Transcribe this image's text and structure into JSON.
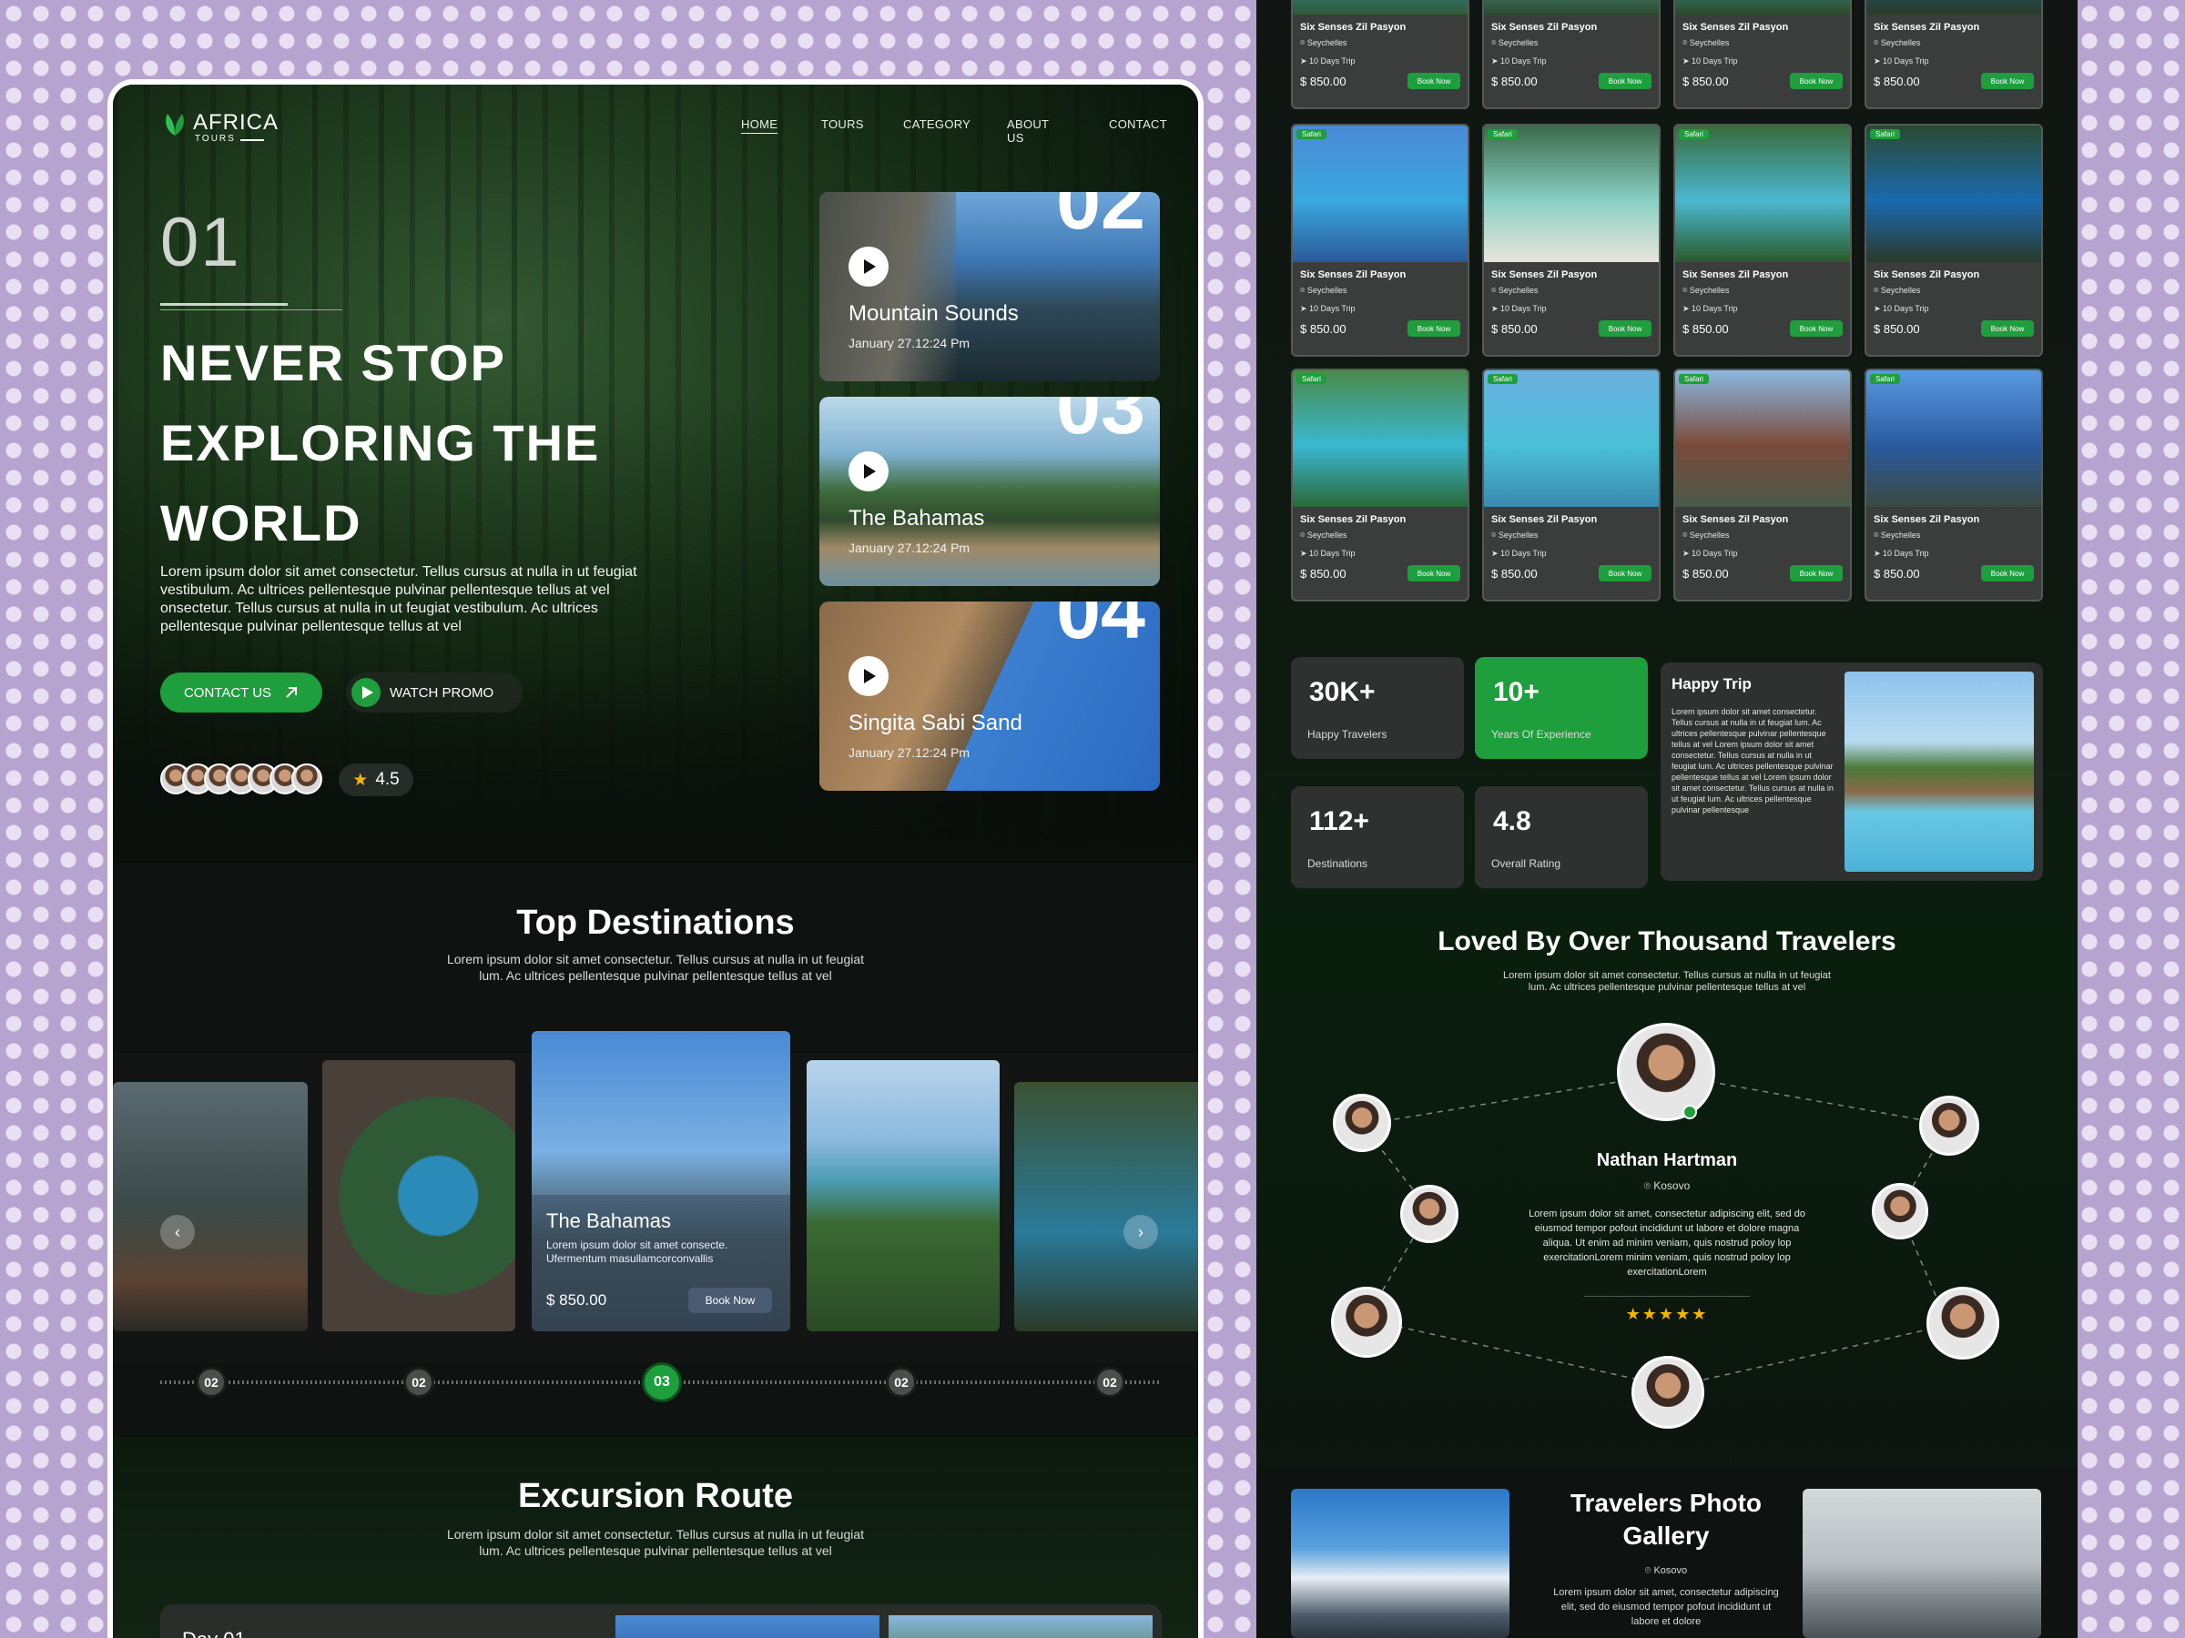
{
  "brand": {
    "name": "AFRICA",
    "sub": "TOURS"
  },
  "nav": {
    "items": [
      "HOME",
      "TOURS",
      "CATEGORY",
      "ABOUT US",
      "CONTACT"
    ],
    "active": "HOME"
  },
  "hero": {
    "number": "01",
    "title": "NEVER STOP EXPLORING THE WORLD",
    "description": "Lorem ipsum dolor sit amet consectetur. Tellus cursus at nulla in ut feugiat vestibulum. Ac ultrices pellentesque pulvinar pellentesque tellus at vel onsectetur. Tellus cursus at nulla in ut feugiat vestibulum. Ac ultrices pellentesque pulvinar pellentesque tellus at vel",
    "contact_label": "CONTACT US",
    "promo_label": "WATCH PROMO",
    "rating": "4.5"
  },
  "destinations": [
    {
      "num": "02",
      "title": "Mountain Sounds",
      "date": "January 27.12:24 Pm"
    },
    {
      "num": "03",
      "title": "The Bahamas",
      "date": "January 27.12:24 Pm"
    },
    {
      "num": "04",
      "title": "Singita Sabi Sand",
      "date": "January 27.12:24 Pm"
    }
  ],
  "top": {
    "title": "Top Destinations",
    "desc_line1": "Lorem ipsum dolor sit amet consectetur. Tellus cursus at nulla in ut feugiat",
    "desc_line2": "lum. Ac ultrices pellentesque pulvinar pellentesque tellus at vel",
    "featured": {
      "title": "The Bahamas",
      "desc": "Lorem ipsum dolor sit amet consecte. Ufermentum masullamcorconvallis",
      "price": "$ 850.00",
      "book": "Book Now"
    },
    "steps": [
      "02",
      "02",
      "03",
      "02",
      "02"
    ],
    "active_step": "03"
  },
  "excursion": {
    "title": "Excursion Route",
    "desc_line1": "Lorem ipsum dolor sit amet consectetur. Tellus cursus at nulla in ut feugiat",
    "desc_line2": "lum. Ac ultrices pellentesque pulvinar pellentesque tellus at vel",
    "day": "Day 01"
  },
  "hotel_card": {
    "tag": "Safari",
    "name": "Six Senses Zil Pasyon",
    "location": "Seychelles",
    "trip": "10 Days Trip",
    "price": "$ 850.00",
    "book": "Book Now"
  },
  "stats": [
    {
      "value": "30K+",
      "label": "Happy Travelers"
    },
    {
      "value": "10+",
      "label": "Years Of Experience"
    },
    {
      "value": "112+",
      "label": "Destinations"
    },
    {
      "value": "4.8",
      "label": "Overall Rating"
    }
  ],
  "happy_trip": {
    "title": "Happy Trip",
    "text": "Lorem ipsum dolor sit amet consectetur. Tellus cursus at nulla in ut feugiat lum. Ac ultrices pellentesque pulvinar pellentesque tellus at vel Lorem ipsum dolor sit amet consectetur. Tellus cursus at nulla in ut feugiat lum. Ac ultrices pellentesque pulvinar pellentesque tellus at vel Lorem ipsum dolor sit amet consectetur. Tellus cursus at nulla in ut feugiat lum. Ac ultrices pellentesque pulvinar pellentesque"
  },
  "testimonials": {
    "title": "Loved By Over Thousand Travelers",
    "desc_line1": "Lorem ipsum dolor sit amet consectetur. Tellus cursus at nulla in ut feugiat",
    "desc_line2": "lum. Ac ultrices pellentesque pulvinar pellentesque tellus at vel",
    "name": "Nathan Hartman",
    "location": "Kosovo",
    "quote": "Lorem ipsum dolor sit amet, consectetur adipiscing elit, sed do eiusmod tempor pofout incididunt ut labore et dolore magna aliqua. Ut enim ad minim veniam, quis nostrud poloy lop exercitationLorem minim veniam, quis nostrud poloy lop exercitationLorem",
    "stars": 5
  },
  "gallery": {
    "title_line1": "Travelers Photo",
    "title_line2": "Gallery",
    "location": "Kosovo",
    "desc": "Lorem ipsum dolor sit amet, consectetur adipiscing elit, sed do eiusmod tempor pofout incididunt ut labore et dolore"
  },
  "colors": {
    "accent": "#1e9e3d",
    "bg_dark": "#0e1210",
    "card": "#3a3d3b",
    "star": "#f4b400"
  },
  "icons": [
    "leaf-logo-icon",
    "arrow-up-right-icon",
    "play-icon",
    "star-icon",
    "chevron-left-icon",
    "chevron-right-icon",
    "location-pin-icon",
    "send-icon"
  ]
}
